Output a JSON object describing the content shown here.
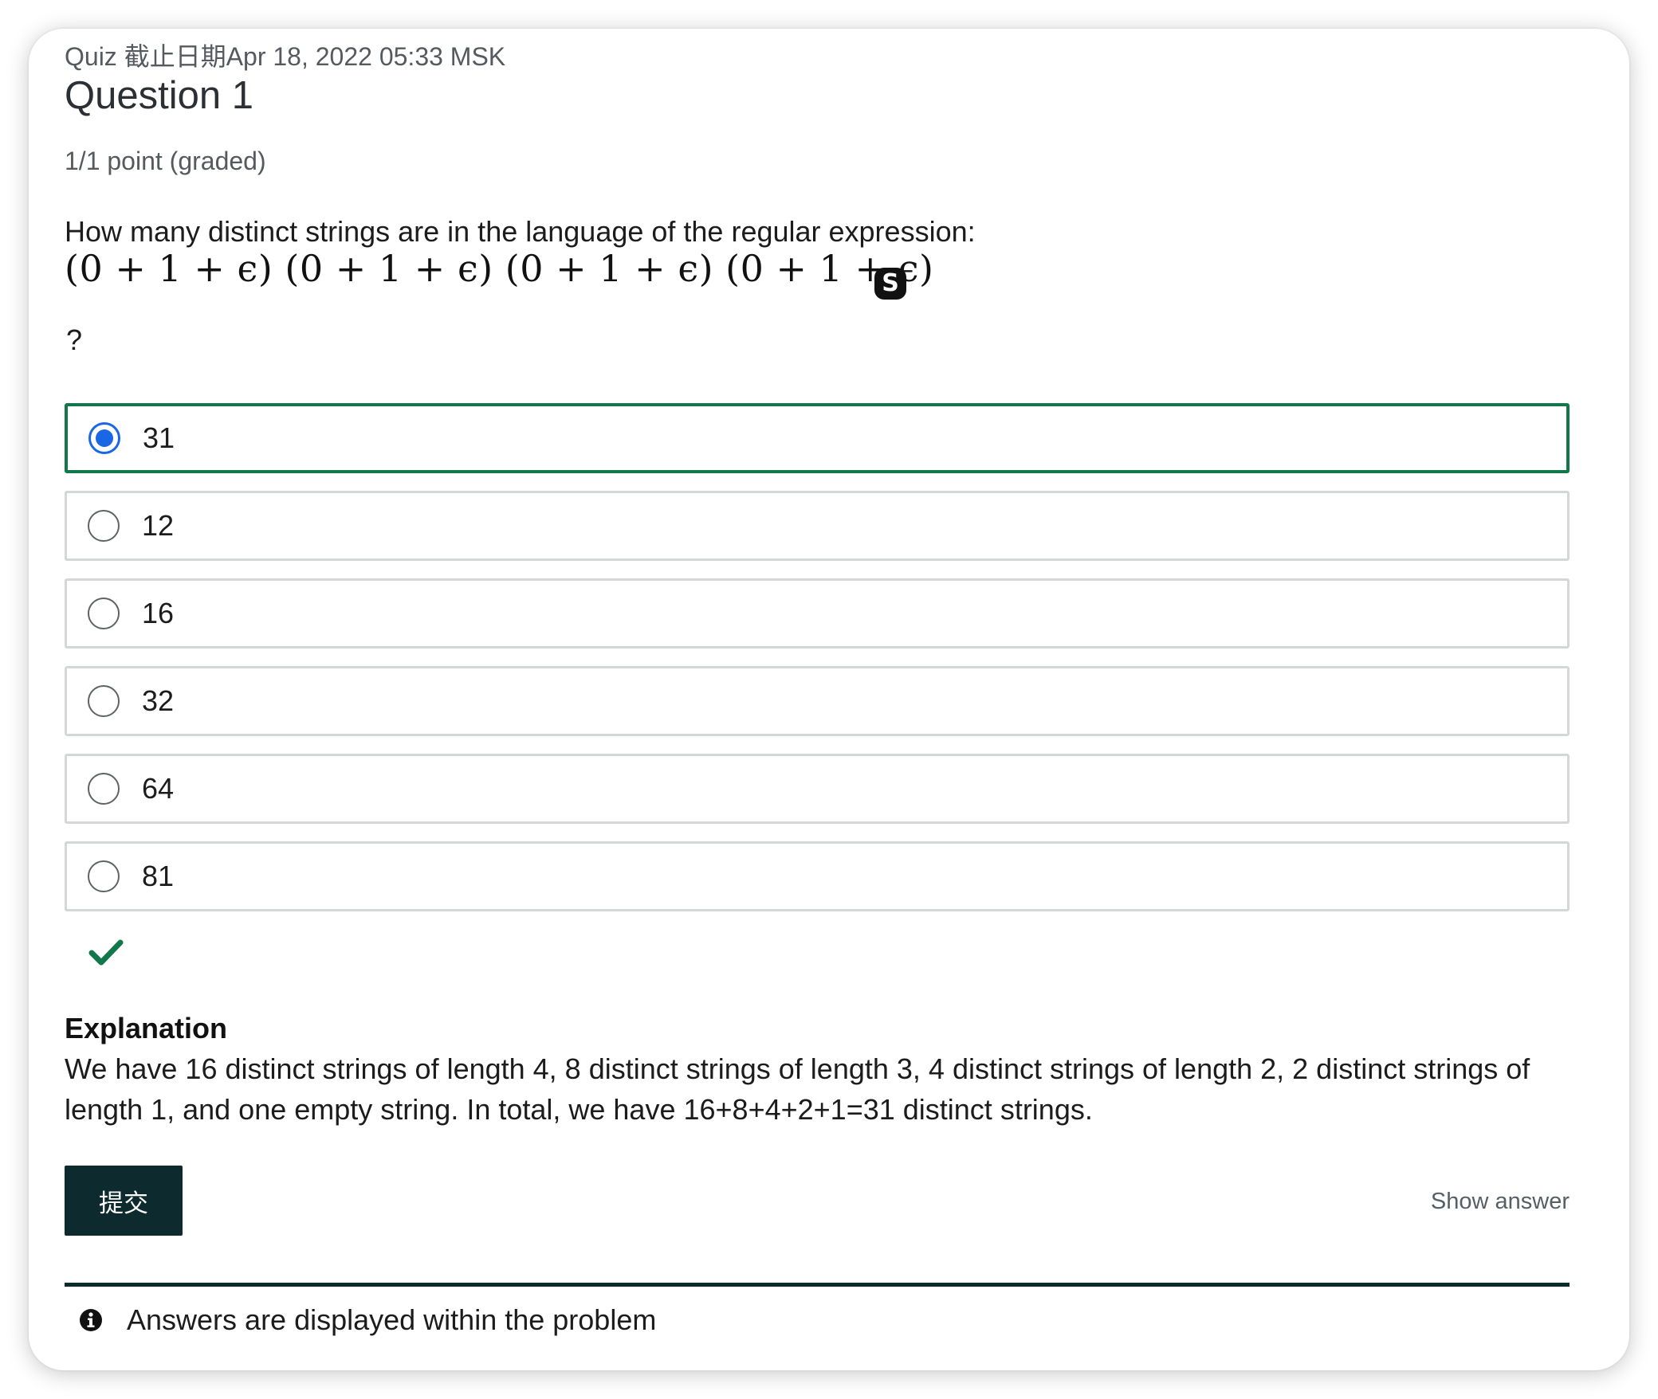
{
  "header": {
    "subtitle": "Quiz 截止日期Apr 18, 2022 05:33 MSK",
    "title": "Question 1",
    "points": "1/1 point (graded)"
  },
  "question": {
    "prompt": "How many distinct strings are in the language of the regular expression:",
    "formula": "(0 + 1 + ϵ) (0 + 1 + ϵ) (0 + 1 + ϵ) (0 + 1 + ϵ)",
    "trailing": "?"
  },
  "options": [
    {
      "label": "31",
      "selected": true
    },
    {
      "label": "12",
      "selected": false
    },
    {
      "label": "16",
      "selected": false
    },
    {
      "label": "32",
      "selected": false
    },
    {
      "label": "64",
      "selected": false
    },
    {
      "label": "81",
      "selected": false
    }
  ],
  "result": {
    "icon": "check-icon",
    "color": "#12784b"
  },
  "explanation": {
    "title": "Explanation",
    "body": "We have 16 distinct strings of length 4, 8 distinct strings of length 3, 4 distinct strings of length 2, 2 distinct strings of length 1, and one empty string. In total, we have 16+8+4+2+1=31 distinct strings."
  },
  "actions": {
    "submit_label": "提交",
    "show_answer_label": "Show answer"
  },
  "notice": {
    "icon": "info-icon",
    "text": "Answers are displayed within the problem"
  },
  "overlay": {
    "badge_letter": "S"
  },
  "colors": {
    "accent_blue": "#1a67e6",
    "correct_green": "#12784b",
    "button_dark": "#0d2b2f"
  }
}
